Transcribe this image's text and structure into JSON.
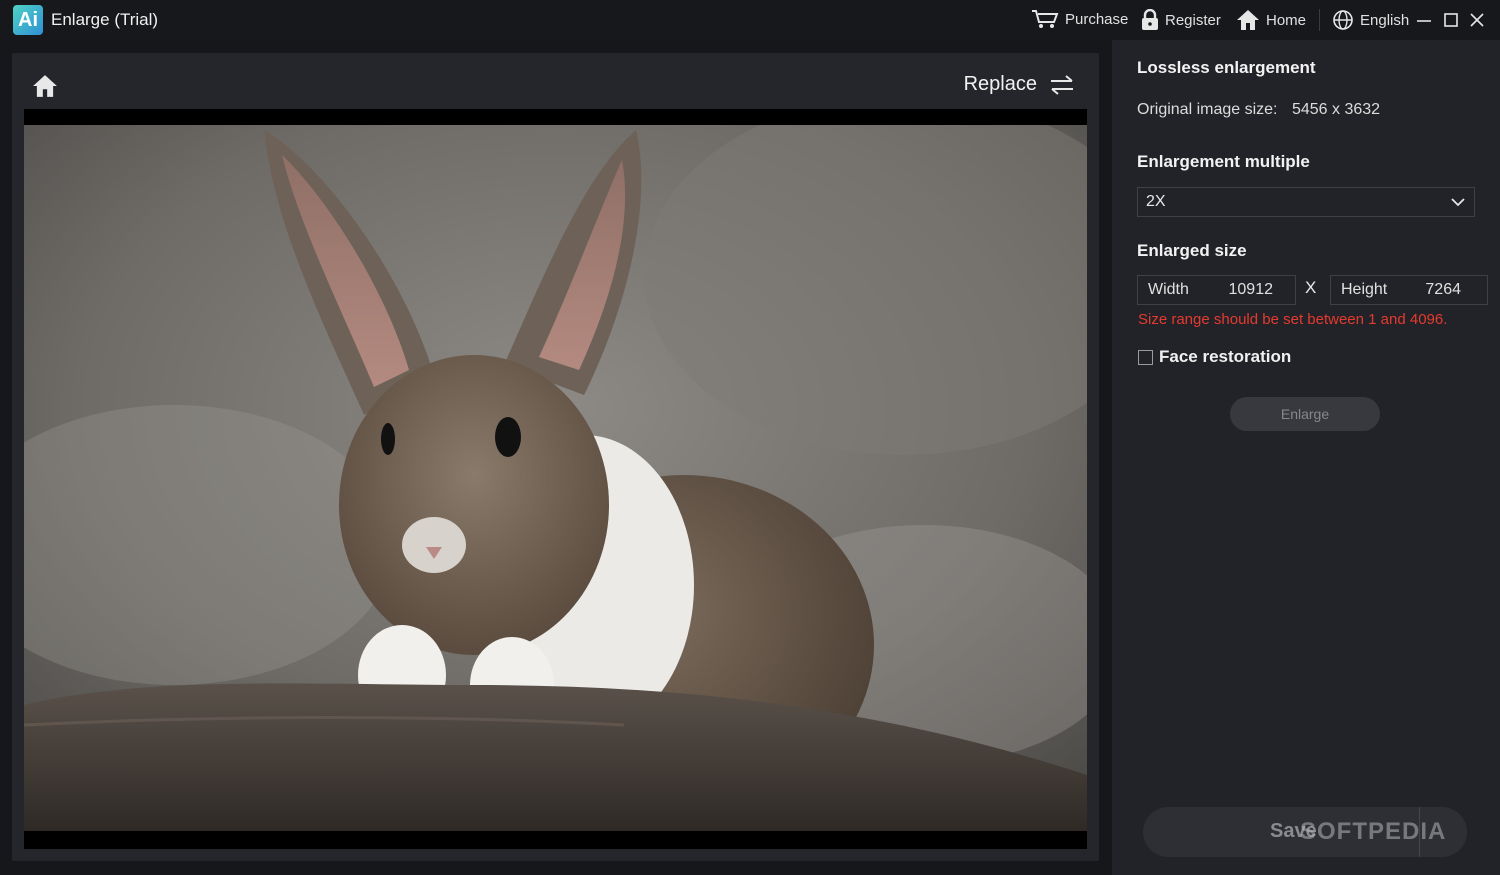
{
  "window": {
    "title": "Enlarge (Trial)",
    "logo_text": "Ai"
  },
  "toolbar": {
    "purchase": "Purchase",
    "register": "Register",
    "home": "Home",
    "language": "English"
  },
  "main": {
    "replace_label": "Replace"
  },
  "side": {
    "lossless_title": "Lossless enlargement",
    "original_label": "Original image size:",
    "original_value": "5456 x 3632",
    "multiple_title": "Enlargement multiple",
    "multiple_value": "2X",
    "enlarged_title": "Enlarged size",
    "width_label": "Width",
    "width_value": "10912",
    "times": "X",
    "height_label": "Height",
    "height_value": "7264",
    "error": "Size range should be set between 1 and 4096.",
    "face_label": "Face restoration",
    "enlarge_button": "Enlarge",
    "save_button": "Save"
  },
  "watermark": "SOFTPEDIA",
  "colors": {
    "error": "#e53a2f",
    "background": "#16171b",
    "panel": "#25262b"
  }
}
